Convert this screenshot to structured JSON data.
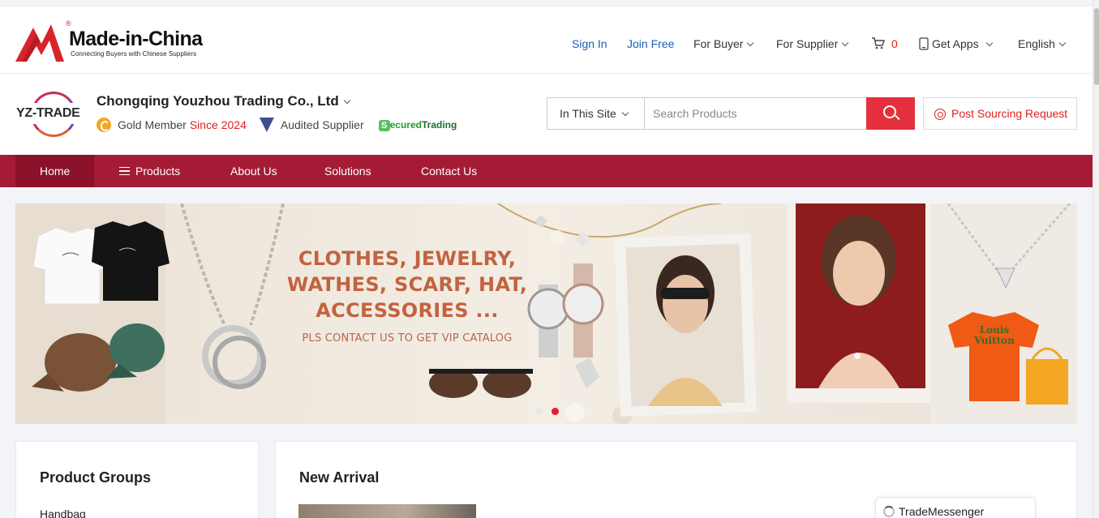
{
  "header": {
    "logo_brand": "Made-in-China",
    "logo_reg": "®",
    "logo_tagline": "Connecting Buyers with Chinese Suppliers",
    "sign_in": "Sign In",
    "join_free": "Join Free",
    "for_buyer": "For Buyer",
    "for_supplier": "For Supplier",
    "cart_count": "0",
    "get_apps": "Get Apps",
    "language": "English"
  },
  "company": {
    "logo_text": "YZ-TRADE",
    "name": "Chongqing Youzhou Trading Co., Ltd",
    "member_label": "Gold Member",
    "member_since": "Since 2024",
    "audited": "Audited Supplier",
    "secured_s": "S",
    "secured_rest": "ecured",
    "secured_trading": "Trading"
  },
  "search": {
    "scope": "In This Site",
    "placeholder": "Search Products",
    "post_request": "Post Sourcing Request"
  },
  "nav": {
    "home": "Home",
    "products": "Products",
    "about": "About Us",
    "solutions": "Solutions",
    "contact": "Contact Us"
  },
  "banner": {
    "line1": "CLOTHES, JEWELRY,",
    "line2": "WATHES, SCARF, HAT,",
    "line3": "ACCESSORIES ...",
    "sub": "PLS CONTACT US TO GET VIP CATALOG",
    "shirt_text": "Louis Vuitton",
    "slide_count": 2,
    "active_slide": 2
  },
  "sidebar": {
    "title": "Product Groups",
    "items": [
      "Handbag"
    ]
  },
  "main": {
    "title": "New Arrival"
  },
  "trade_messenger": "TradeMessenger",
  "colors": {
    "brand_red": "#a51b35",
    "search_red": "#e3303c",
    "link_blue": "#1a5fb4"
  }
}
